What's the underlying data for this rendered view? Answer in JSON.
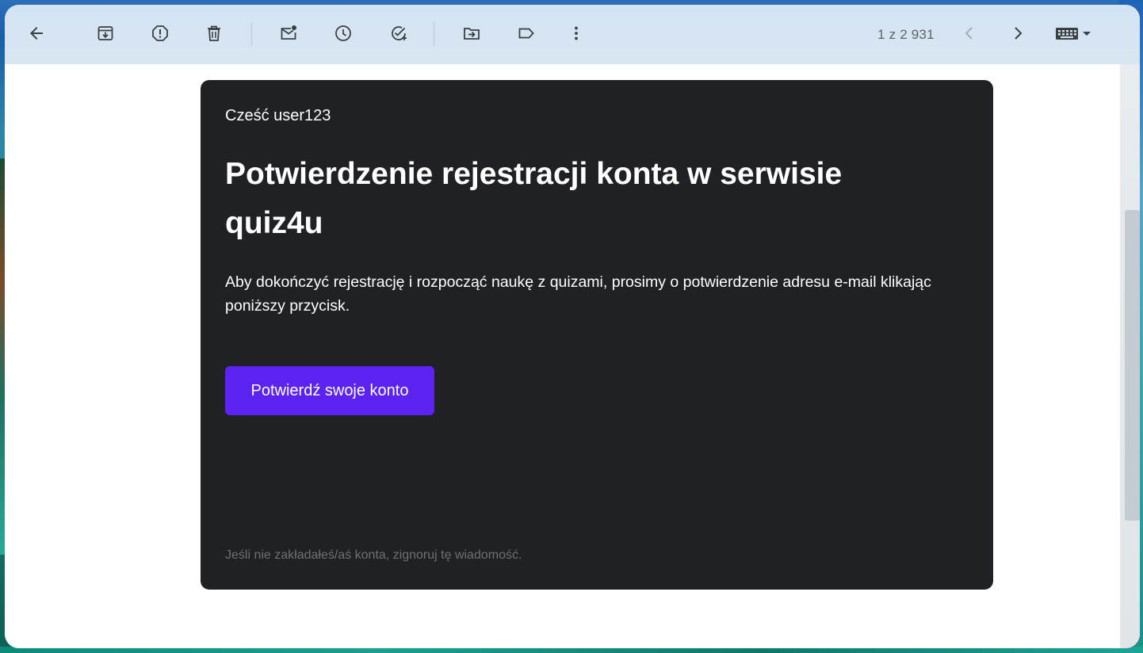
{
  "toolbar": {
    "back_icon": "arrow-left-icon",
    "archive_icon": "archive-icon",
    "spam_icon": "report-spam-icon",
    "delete_icon": "trash-icon",
    "mark_unread_icon": "mark-unread-icon",
    "snooze_icon": "clock-icon",
    "add_task_icon": "add-task-icon",
    "move_to_icon": "move-to-folder-icon",
    "label_icon": "label-icon",
    "more_icon": "more-vertical-icon",
    "pager_text": "1 z 2 931",
    "prev_icon": "chevron-left-icon",
    "next_icon": "chevron-right-icon",
    "input_tools_icon": "keyboard-icon"
  },
  "email": {
    "greeting": "Cześć user123",
    "headline": "Potwierdzenie rejestracji konta w serwisie quiz4u",
    "body": "Aby dokończyć rejestrację i rozpocząć naukę z quizami, prosimy o potwierdzenie adresu e-mail klikając poniższy przycisk.",
    "cta_label": "Potwierdź swoje konto",
    "footer": "Jeśli nie zakładałeś/aś konta, zignoruj tę wiadomość."
  },
  "colors": {
    "toolbar_bg": "#d3e3f4",
    "card_bg": "#202124",
    "cta_bg": "#5b22f0",
    "footer_text": "#6e7074"
  }
}
